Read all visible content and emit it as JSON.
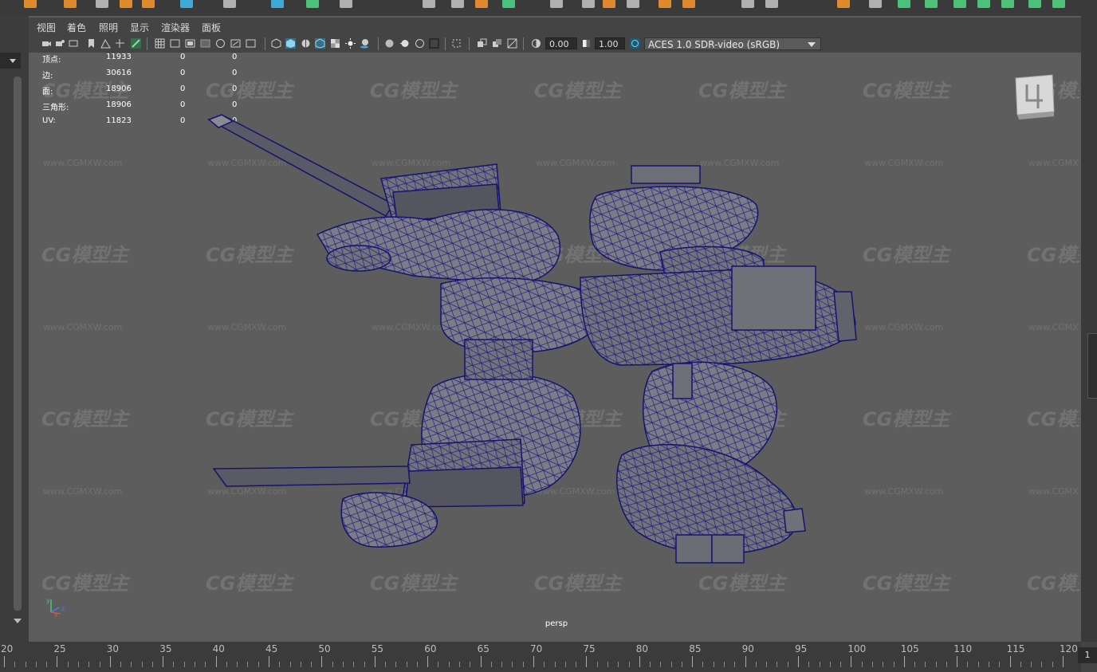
{
  "menu": {
    "items": [
      "视图",
      "着色",
      "照明",
      "显示",
      "渲染器",
      "面板"
    ]
  },
  "toolbar": {
    "exposure_value": "0.00",
    "gamma_value": "1.00",
    "color_space": "ACES 1.0 SDR-video (sRGB)"
  },
  "stats": {
    "rows": [
      {
        "label": "顶点:",
        "value": "11933",
        "selected": "0",
        "components": "0"
      },
      {
        "label": "边:",
        "value": "30616",
        "selected": "0",
        "components": "0"
      },
      {
        "label": "面:",
        "value": "18906",
        "selected": "0",
        "components": "0"
      },
      {
        "label": "三角形:",
        "value": "18906",
        "selected": "0",
        "components": "0"
      },
      {
        "label": "UV:",
        "value": "11823",
        "selected": "0",
        "components": "0"
      }
    ]
  },
  "viewport": {
    "camera_name": "persp",
    "watermark_logo": "CG模型主",
    "watermark_url": "www.CGMXW.com",
    "wireframe_color": "#1a1a7a",
    "mesh_color": "#7e7e86",
    "axis_labels": {
      "y": "y",
      "x": "x",
      "z": "z"
    }
  },
  "timeline": {
    "ticks": [
      "20",
      "25",
      "30",
      "35",
      "40",
      "45",
      "50",
      "55",
      "60",
      "65",
      "70",
      "75",
      "80",
      "85",
      "90",
      "95",
      "100",
      "105",
      "110",
      "115",
      "120"
    ],
    "current_frame": "1"
  },
  "colors": {
    "viewport_bg": "#5d5d5d",
    "panel_bg": "#444444",
    "accent_blue": "#3fa9d8",
    "accent_orange": "#e08a2e",
    "accent_green": "#4cc17a"
  }
}
